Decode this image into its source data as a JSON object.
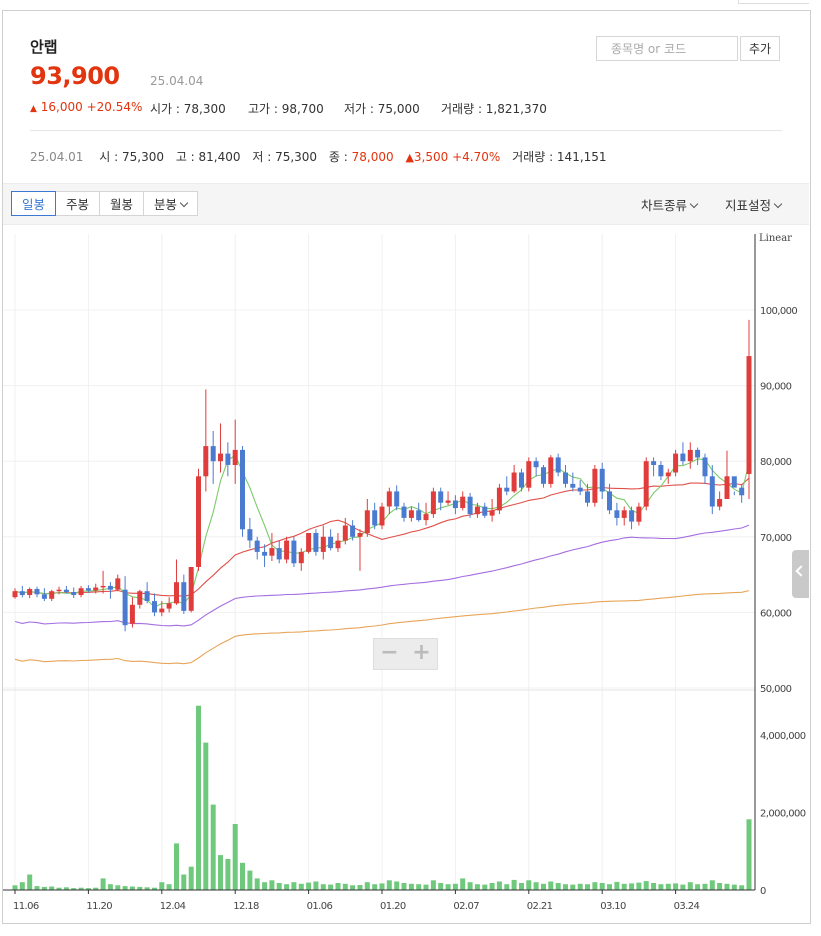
{
  "stock": {
    "name": "안랩",
    "price": "93,900",
    "date": "25.04.04",
    "change_arrow": "▲",
    "change_amount": "16,000",
    "change_pct": "+20.54%",
    "open_label": "시가",
    "open": "78,300",
    "high_label": "고가",
    "high": "98,700",
    "low_label": "저가",
    "low": "75,000",
    "volume_label": "거래량",
    "volume": "1,821,370"
  },
  "search": {
    "placeholder": "종목명 or 코드",
    "add_label": "추가"
  },
  "prev": {
    "date": "25.04.01",
    "open_label": "시",
    "open": "75,300",
    "high_label": "고",
    "high": "81,400",
    "low_label": "저",
    "low": "75,300",
    "close_label": "종",
    "close": "78,000",
    "change_arrow": "▲",
    "change": "3,500",
    "change_pct": "+4.70%",
    "volume_label": "거래량",
    "volume": "141,151"
  },
  "toolbar": {
    "tabs": [
      "일봉",
      "주봉",
      "월봉",
      "분봉"
    ],
    "active_tab": "일봉",
    "chart_type_label": "차트종류",
    "indicator_label": "지표설정"
  },
  "zoom": {
    "minus": "−",
    "plus": "+"
  },
  "colors": {
    "up": "#e03c3c",
    "down": "#4a7bd0",
    "volume": "#6fc97c",
    "ma5": "#7ccb6a",
    "ma20": "#e0504a",
    "ma60": "#a56ee0",
    "ma120": "#e8a55a",
    "accent": "#e2340e"
  },
  "chart_data": {
    "type": "candlestick",
    "scale_label": "Linear",
    "price_axis": {
      "min": 50000,
      "max": 100000,
      "ticks": [
        "100,000",
        "90,000",
        "80,000",
        "70,000",
        "60,000",
        "50,000"
      ]
    },
    "volume_axis": {
      "min": 0,
      "max": 5000000,
      "ticks": [
        "4,000,000",
        "2,000,000",
        "0"
      ]
    },
    "x_ticks": [
      {
        "index": 0,
        "label": "11.06"
      },
      {
        "index": 10,
        "label": "11.20"
      },
      {
        "index": 20,
        "label": "12.04"
      },
      {
        "index": 30,
        "label": "12.18"
      },
      {
        "index": 40,
        "label": "01.06"
      },
      {
        "index": 50,
        "label": "01.20"
      },
      {
        "index": 60,
        "label": "02.07"
      },
      {
        "index": 70,
        "label": "02.21"
      },
      {
        "index": 80,
        "label": "03.10"
      },
      {
        "index": 90,
        "label": "03.24"
      }
    ],
    "ohlc": [
      [
        62000,
        63200,
        61800,
        62800
      ],
      [
        62800,
        63500,
        62000,
        62300
      ],
      [
        62300,
        63300,
        61900,
        63100
      ],
      [
        63100,
        63400,
        62000,
        62400
      ],
      [
        62400,
        63200,
        61500,
        61800
      ],
      [
        61800,
        63000,
        61500,
        62800
      ],
      [
        62800,
        63400,
        62400,
        63000
      ],
      [
        63000,
        63500,
        62500,
        62700
      ],
      [
        62700,
        63300,
        61900,
        62300
      ],
      [
        62300,
        63500,
        62000,
        63200
      ],
      [
        63200,
        63600,
        62600,
        62900
      ],
      [
        62900,
        63800,
        62500,
        63300
      ],
      [
        63300,
        65500,
        62500,
        63500
      ],
      [
        63500,
        64000,
        61800,
        63000
      ],
      [
        63000,
        65000,
        62800,
        64500
      ],
      [
        63000,
        64800,
        57500,
        58300
      ],
      [
        58500,
        62000,
        58000,
        61000
      ],
      [
        61000,
        63000,
        60500,
        62800
      ],
      [
        62800,
        64000,
        61200,
        61500
      ],
      [
        61500,
        62500,
        59500,
        60000
      ],
      [
        60000,
        61500,
        59500,
        60500
      ],
      [
        60500,
        62000,
        60000,
        61200
      ],
      [
        61200,
        67000,
        61000,
        64000
      ],
      [
        64000,
        65000,
        59800,
        60200
      ],
      [
        60200,
        66000,
        60000,
        66000
      ],
      [
        66000,
        79000,
        65500,
        78000
      ],
      [
        78000,
        89500,
        76000,
        82000
      ],
      [
        82000,
        84000,
        77000,
        80000
      ],
      [
        80000,
        85000,
        78500,
        81000
      ],
      [
        81000,
        82500,
        78000,
        79500
      ],
      [
        79500,
        85500,
        77000,
        81500
      ],
      [
        81500,
        82000,
        70000,
        71000
      ],
      [
        71000,
        72500,
        68500,
        69500
      ],
      [
        69500,
        70000,
        67000,
        68000
      ],
      [
        68000,
        69000,
        66000,
        67500
      ],
      [
        67500,
        70500,
        66800,
        68500
      ],
      [
        68500,
        69500,
        66500,
        67000
      ],
      [
        67000,
        70000,
        66500,
        69500
      ],
      [
        69500,
        70000,
        66000,
        66500
      ],
      [
        66500,
        68500,
        65500,
        68000
      ],
      [
        68000,
        70500,
        67800,
        70500
      ],
      [
        70500,
        71000,
        67500,
        68000
      ],
      [
        68000,
        71500,
        67000,
        70000
      ],
      [
        70000,
        71000,
        68200,
        68500
      ],
      [
        68500,
        70500,
        68000,
        69500
      ],
      [
        69500,
        72500,
        69000,
        71500
      ],
      [
        71500,
        72200,
        69500,
        70000
      ],
      [
        70000,
        71000,
        65500,
        70500
      ],
      [
        70500,
        75000,
        70000,
        73500
      ],
      [
        73500,
        74500,
        71000,
        71500
      ],
      [
        71500,
        74500,
        71000,
        74000
      ],
      [
        74000,
        76500,
        73000,
        76000
      ],
      [
        76000,
        76800,
        73500,
        74000
      ],
      [
        74000,
        74500,
        72000,
        72500
      ],
      [
        72500,
        74000,
        72000,
        73500
      ],
      [
        73500,
        74500,
        72000,
        72200
      ],
      [
        72200,
        74500,
        71500,
        73000
      ],
      [
        73000,
        76500,
        72500,
        76000
      ],
      [
        76000,
        76500,
        73500,
        74500
      ],
      [
        74500,
        76000,
        74200,
        74800
      ],
      [
        74800,
        75500,
        73000,
        73800
      ],
      [
        73800,
        76000,
        73500,
        75300
      ],
      [
        75300,
        75800,
        72500,
        73000
      ],
      [
        73000,
        74500,
        72500,
        74000
      ],
      [
        74000,
        74500,
        72500,
        72800
      ],
      [
        72800,
        75000,
        72000,
        73500
      ],
      [
        73500,
        77000,
        73000,
        76500
      ],
      [
        76500,
        78000,
        75500,
        76000
      ],
      [
        76000,
        79500,
        75800,
        78500
      ],
      [
        78500,
        79000,
        76000,
        76500
      ],
      [
        76500,
        80500,
        76000,
        80000
      ],
      [
        80000,
        80500,
        78000,
        79200
      ],
      [
        79200,
        79500,
        76500,
        77000
      ],
      [
        77000,
        80800,
        76500,
        80500
      ],
      [
        80500,
        81000,
        78000,
        78500
      ],
      [
        78500,
        79500,
        76500,
        77000
      ],
      [
        77000,
        78500,
        76000,
        76500
      ],
      [
        76500,
        77500,
        75500,
        76000
      ],
      [
        76000,
        77000,
        74000,
        74500
      ],
      [
        74500,
        79500,
        74000,
        79000
      ],
      [
        79000,
        79800,
        75000,
        76000
      ],
      [
        76000,
        77000,
        73000,
        73500
      ],
      [
        73500,
        74500,
        71500,
        72500
      ],
      [
        72500,
        74000,
        71500,
        73500
      ],
      [
        73500,
        74000,
        71000,
        72000
      ],
      [
        72000,
        74500,
        71500,
        74000
      ],
      [
        74000,
        80500,
        73500,
        80000
      ],
      [
        80000,
        80500,
        78000,
        79500
      ],
      [
        79500,
        80000,
        77500,
        78000
      ],
      [
        78000,
        79000,
        77000,
        78500
      ],
      [
        78500,
        81500,
        78000,
        81000
      ],
      [
        81000,
        82500,
        79500,
        80000
      ],
      [
        80000,
        82500,
        79000,
        81500
      ],
      [
        81500,
        81800,
        79500,
        80500
      ],
      [
        80500,
        81000,
        77000,
        78000
      ],
      [
        78000,
        79500,
        73000,
        74000
      ],
      [
        74000,
        76000,
        73500,
        75000
      ],
      [
        75000,
        81400,
        75000,
        78000
      ],
      [
        78000,
        76000,
        75500,
        76500
      ],
      [
        76500,
        77000,
        74500,
        75500
      ],
      [
        78300,
        98700,
        75000,
        93900
      ]
    ],
    "volume": [
      120000,
      200000,
      400000,
      100000,
      80000,
      90000,
      60000,
      70000,
      50000,
      60000,
      50000,
      60000,
      300000,
      150000,
      120000,
      100000,
      90000,
      80000,
      70000,
      60000,
      200000,
      150000,
      1200000,
      400000,
      600000,
      4750000,
      3800000,
      2200000,
      900000,
      800000,
      1700000,
      700000,
      500000,
      300000,
      200000,
      250000,
      180000,
      150000,
      200000,
      160000,
      190000,
      220000,
      150000,
      140000,
      180000,
      160000,
      120000,
      130000,
      200000,
      150000,
      170000,
      250000,
      220000,
      180000,
      160000,
      150000,
      140000,
      250000,
      180000,
      150000,
      160000,
      300000,
      200000,
      150000,
      140000,
      180000,
      220000,
      150000,
      260000,
      180000,
      250000,
      200000,
      160000,
      220000,
      180000,
      150000,
      140000,
      160000,
      150000,
      200000,
      180000,
      150000,
      210000,
      160000,
      170000,
      190000,
      230000,
      180000,
      150000,
      160000,
      170000,
      140000,
      200000,
      150000,
      160000,
      250000,
      180000,
      160000,
      140000,
      120000,
      1821370
    ],
    "indicators": [
      "MA5",
      "MA20",
      "MA60",
      "MA120"
    ]
  }
}
